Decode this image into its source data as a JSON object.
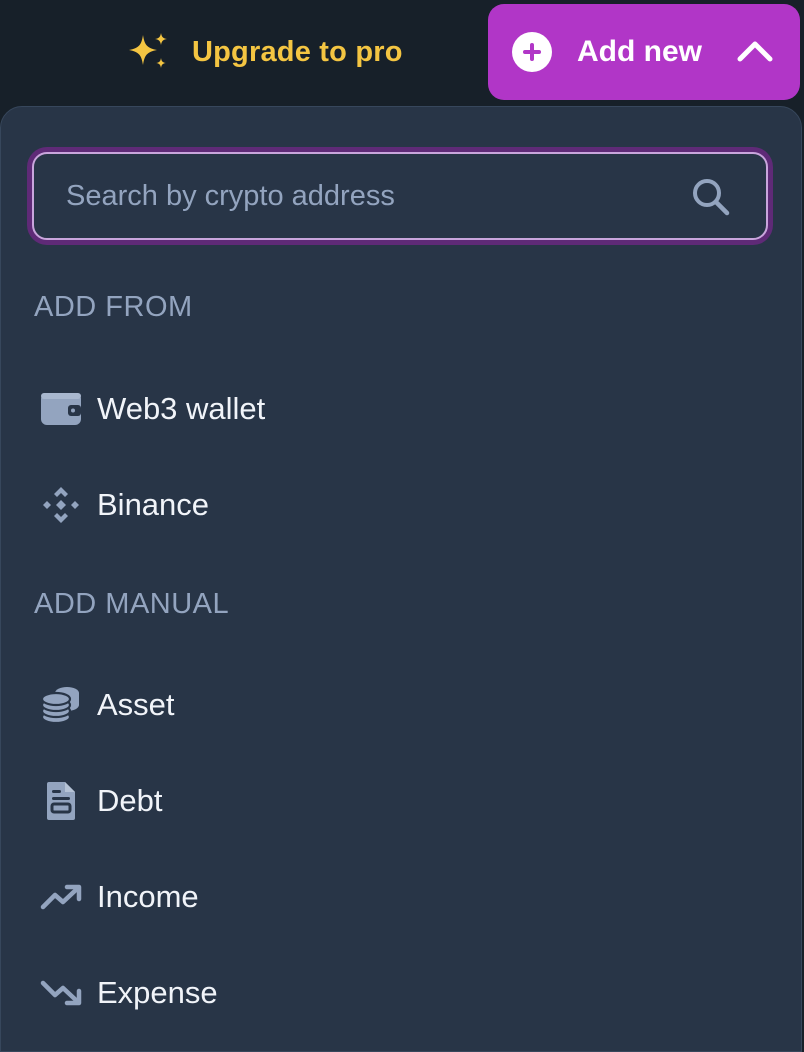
{
  "header": {
    "upgrade_label": "Upgrade to pro",
    "add_new_label": "Add new"
  },
  "search": {
    "placeholder": "Search by crypto address",
    "value": ""
  },
  "sections": {
    "add_from": {
      "label": "ADD FROM",
      "items": [
        {
          "label": "Web3 wallet",
          "icon": "wallet-icon"
        },
        {
          "label": "Binance",
          "icon": "binance-icon"
        }
      ]
    },
    "add_manual": {
      "label": "ADD MANUAL",
      "items": [
        {
          "label": "Asset",
          "icon": "coins-icon"
        },
        {
          "label": "Debt",
          "icon": "document-icon"
        },
        {
          "label": "Income",
          "icon": "trending-up-icon"
        },
        {
          "label": "Expense",
          "icon": "trending-down-icon"
        }
      ]
    }
  },
  "colors": {
    "background": "#172029",
    "panel": "#283547",
    "accent": "#b136c7",
    "upgrade": "#f4c542",
    "muted": "#93a4bf",
    "text": "#f1f4f9"
  }
}
